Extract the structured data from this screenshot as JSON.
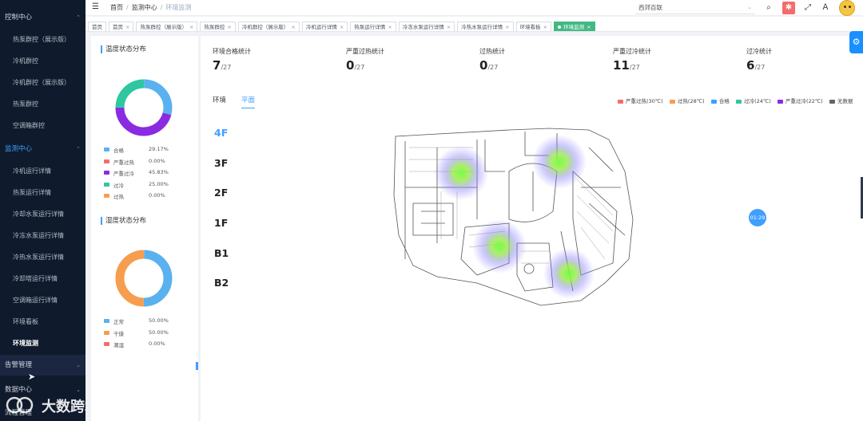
{
  "sidebar": {
    "groups": [
      {
        "label": "控制中心",
        "items": [
          "热泵群控（展示版）",
          "冷机群控",
          "冷机群控（展示版）",
          "热泵群控",
          "空调箱群控"
        ]
      },
      {
        "label": "监测中心",
        "items": [
          "冷机运行详情",
          "热泵运行详情",
          "冷却水泵运行详情",
          "冷冻水泵运行详情",
          "冷热水泵运行详情",
          "冷却塔运行详情",
          "空调箱运行详情",
          "环境看板",
          "环境监测"
        ]
      },
      {
        "label": "告警管理"
      },
      {
        "label": "数据中心"
      },
      {
        "label": "流程管理"
      }
    ],
    "watermark": "大数跨境"
  },
  "header": {
    "breadcrumb": [
      "首页",
      "监测中心",
      "环境监测"
    ],
    "org_select": "西郊百联"
  },
  "tags": [
    "首页",
    "首页",
    "热泵群控（展示版）",
    "热泵群控",
    "冷机群控（展示版）",
    "冷机运行详情",
    "热泵运行详情",
    "冷冻水泵运行详情",
    "冷热水泵运行详情",
    "环境看板",
    "环境监测"
  ],
  "temperature": {
    "title": "温度状态分布",
    "legend": [
      {
        "name": "合格",
        "percent": "29.17%",
        "value": 29.17,
        "color": "#5ab1ef"
      },
      {
        "name": "严重过热",
        "percent": "0.00%",
        "value": 0,
        "color": "#f56c6c"
      },
      {
        "name": "严重过冷",
        "percent": "45.83%",
        "value": 45.83,
        "color": "#8a2be2"
      },
      {
        "name": "过冷",
        "percent": "25.00%",
        "value": 25.0,
        "color": "#2ec7a0"
      },
      {
        "name": "过热",
        "percent": "0.00%",
        "value": 0,
        "color": "#f79d4f"
      }
    ]
  },
  "humidity": {
    "title": "湿度状态分布",
    "legend": [
      {
        "name": "正常",
        "percent": "50.00%",
        "value": 50,
        "color": "#5ab1ef"
      },
      {
        "name": "干燥",
        "percent": "50.00%",
        "value": 50,
        "color": "#f79d4f"
      },
      {
        "name": "潮湿",
        "percent": "0.00%",
        "value": 0,
        "color": "#f56c6c"
      }
    ]
  },
  "stats": [
    {
      "label": "环境合格统计",
      "value": "7",
      "total": "/27"
    },
    {
      "label": "严重过热统计",
      "value": "0",
      "total": "/27"
    },
    {
      "label": "过热统计",
      "value": "0",
      "total": "/27"
    },
    {
      "label": "严重过冷统计",
      "value": "11",
      "total": "/27"
    },
    {
      "label": "过冷统计",
      "value": "6",
      "total": "/27"
    }
  ],
  "tabs": [
    "环境",
    "平面"
  ],
  "map_legend": [
    {
      "label": "严重过热(30℃)",
      "color": "#f56c6c"
    },
    {
      "label": "过热(28℃)",
      "color": "#f79d4f"
    },
    {
      "label": "合格",
      "color": "#409eff"
    },
    {
      "label": "过冷(24℃)",
      "color": "#2ec7a0"
    },
    {
      "label": "严重过冷(22℃)",
      "color": "#8a2be2"
    },
    {
      "label": "无数据",
      "color": "#666666"
    }
  ],
  "floors": [
    "4F",
    "3F",
    "2F",
    "1F",
    "B1",
    "B2"
  ],
  "timer": "01:29"
}
